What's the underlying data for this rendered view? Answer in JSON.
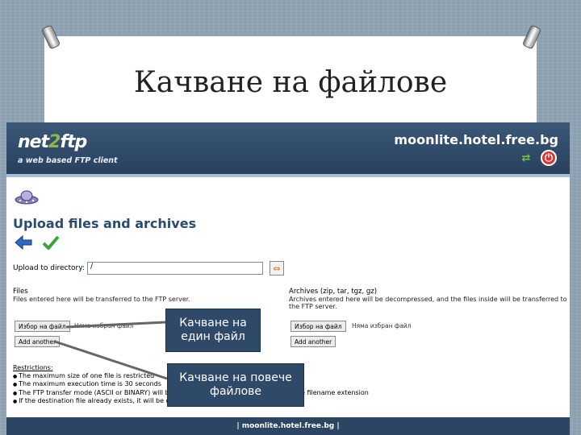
{
  "slide": {
    "title": "Качване на файлове"
  },
  "header": {
    "logo_prefix": "net",
    "logo_two": "2",
    "logo_suffix": "ftp",
    "tagline": "a web based FTP client",
    "server": "moonlite.hotel.free.bg"
  },
  "page": {
    "heading": "Upload files and archives",
    "dir_label": "Upload to directory:",
    "dir_value": "/"
  },
  "files": {
    "heading": "Files",
    "description": "Files entered here will be transferred to the FTP server.",
    "choose_label": "Избор на файл",
    "no_file": "Няма избран файл",
    "add_another": "Add another"
  },
  "archives": {
    "heading": "Archives (zip, tar, tgz, gz)",
    "description": "Archives entered here will be decompressed, and the files inside will be transferred to the FTP server.",
    "choose_label": "Избор на файл",
    "no_file": "Няма избран файл",
    "add_another": "Add another"
  },
  "restrictions": {
    "title": "Restrictions:",
    "items": [
      "The maximum size of one file is restricted",
      "The maximum execution time is 30 seconds",
      "The FTP transfer mode (ASCII or BINARY) will be automatically determined, based on the filename extension",
      "If the destination file already exists, it will be overwritten"
    ]
  },
  "footer": {
    "text": "| moonlite.hotel.free.bg |"
  },
  "callouts": {
    "single": "Качване на един файл",
    "multiple": "Качване на повече файлове"
  },
  "colors": {
    "header_bg": "#2b4563",
    "accent_green": "#8db845",
    "heading_blue": "#2a4a6e",
    "callout_bg": "#2f4a68"
  }
}
